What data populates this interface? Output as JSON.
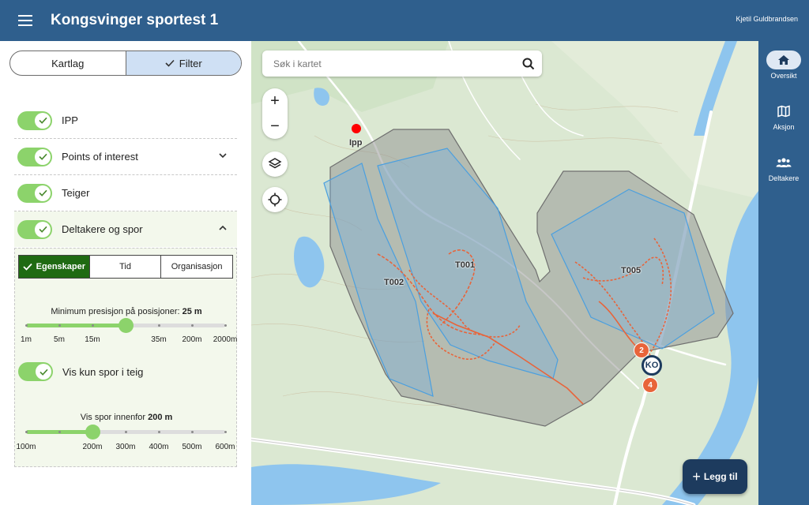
{
  "header": {
    "title": "Kongsvinger sportest 1",
    "user": "Kjetil Guldbrandsen"
  },
  "segment": {
    "left_label": "Kartlag",
    "right_label": "Filter",
    "active": "Filter"
  },
  "layers": [
    {
      "label": "IPP",
      "enabled": true,
      "expandable": false
    },
    {
      "label": "Points of interest",
      "enabled": true,
      "expandable": true,
      "expanded": false
    },
    {
      "label": "Teiger",
      "enabled": true,
      "expandable": false
    },
    {
      "label": "Deltakere og spor",
      "enabled": true,
      "expandable": true,
      "expanded": true
    }
  ],
  "participant_filter": {
    "tabs": [
      "Egenskaper",
      "Tid",
      "Organisasjon"
    ],
    "active_tab": "Egenskaper",
    "precision": {
      "title_prefix": "Minimum presisjon på posisjoner: ",
      "title_value": "25 m",
      "ticks": [
        "1m",
        "5m",
        "15m",
        "25m",
        "35m",
        "200m",
        "2000m"
      ],
      "labels_shown": [
        "1m",
        "5m",
        "15m",
        "35m",
        "200m",
        "2000m"
      ],
      "selected_index": 3
    },
    "only_in_area": {
      "label": "Vis kun spor i teig",
      "enabled": true
    },
    "track_range": {
      "title_prefix": "Vis spor innenfor ",
      "title_value": "200 m",
      "ticks": [
        "100m",
        "150m",
        "200m",
        "300m",
        "400m",
        "500m",
        "600m"
      ],
      "labels_shown": [
        "100m",
        "200m",
        "300m",
        "400m",
        "500m",
        "600m"
      ],
      "selected_index": 2
    }
  },
  "map": {
    "search_placeholder": "Søk i kartet",
    "zoom_in": "+",
    "zoom_out": "−",
    "ipp_label": "Ipp",
    "areas": [
      "T001",
      "T002",
      "T005"
    ],
    "command_post": "KO",
    "markers": [
      "2",
      "4"
    ],
    "add_button": "Legg til"
  },
  "nav": [
    {
      "label": "Oversikt",
      "icon": "home-icon",
      "active": true
    },
    {
      "label": "Aksjon",
      "icon": "map-icon",
      "active": false
    },
    {
      "label": "Deltakere",
      "icon": "people-icon",
      "active": false
    }
  ],
  "colors": {
    "header": "#2f5f8d",
    "toggle_on": "#8cd36b",
    "tab_active": "#1f6a12",
    "area_outer": "#8f8f8f",
    "area_blue": "#4a9fdf",
    "track": "#e8643a",
    "add_button": "#1d3b5e"
  }
}
